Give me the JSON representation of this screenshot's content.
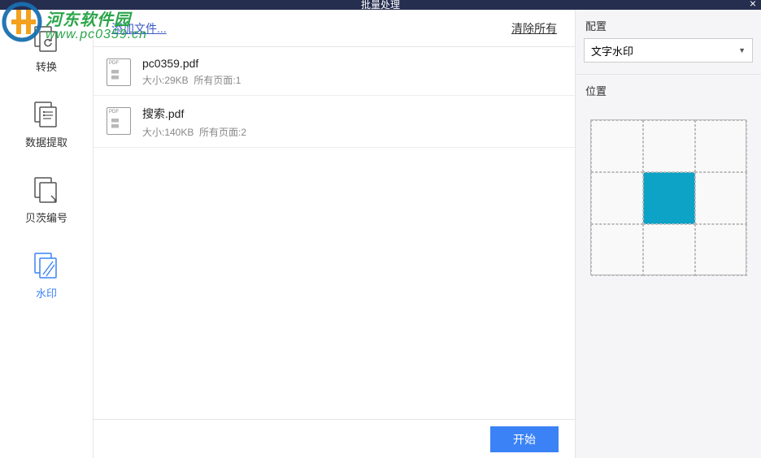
{
  "window": {
    "title": "批量处理"
  },
  "watermark_overlay": {
    "brand": "河东软件园",
    "url": "www.pc0359.cn"
  },
  "sidebar": {
    "items": [
      {
        "label": "转换",
        "active": false
      },
      {
        "label": "数据提取",
        "active": false
      },
      {
        "label": "贝茨编号",
        "active": false
      },
      {
        "label": "水印",
        "active": true
      }
    ]
  },
  "toolbar": {
    "add_file_label": "添加文件...",
    "clear_all_label": "清除所有"
  },
  "files": [
    {
      "name": "pc0359.pdf",
      "size_label": "大小:29KB",
      "pages_label": "所有页面:1"
    },
    {
      "name": "搜索.pdf",
      "size_label": "大小:140KB",
      "pages_label": "所有页面:2"
    }
  ],
  "footer": {
    "start_label": "开始"
  },
  "right_panel": {
    "config_label": "配置",
    "select_value": "文字水印",
    "position_label": "位置",
    "selected_cell": "center"
  }
}
